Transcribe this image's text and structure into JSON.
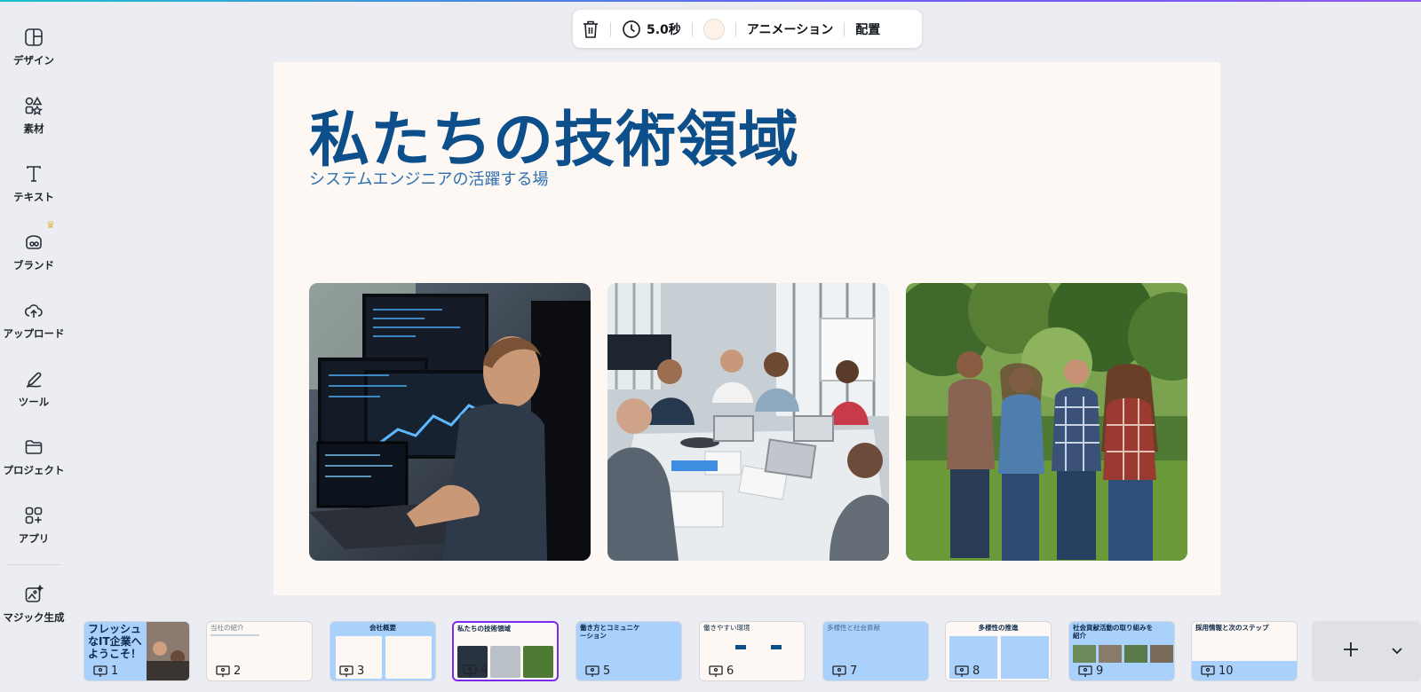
{
  "sidebar": {
    "items": [
      {
        "label": "デザイン",
        "icon": "layout-icon"
      },
      {
        "label": "素材",
        "icon": "shapes-icon"
      },
      {
        "label": "テキスト",
        "icon": "text-icon"
      },
      {
        "label": "ブランド",
        "icon": "brand-icon"
      },
      {
        "label": "アップロード",
        "icon": "cloud-upload-icon"
      },
      {
        "label": "ツール",
        "icon": "pen-tool-icon"
      },
      {
        "label": "プロジェクト",
        "icon": "folder-icon"
      },
      {
        "label": "アプリ",
        "icon": "apps-icon"
      },
      {
        "label": "マジック生成",
        "icon": "magic-image-icon"
      }
    ],
    "crown_icon": "crown-icon"
  },
  "toolbar": {
    "delete_icon": "trash-icon",
    "duration": "5.0秒",
    "animation_label": "アニメーション",
    "position_label": "配置",
    "background_color": "#fdf1e8"
  },
  "slide": {
    "title": "私たちの技術領域",
    "subtitle": "システムエンジニアの活躍する場",
    "background": "#fdf8f4",
    "title_color": "#0c4f8a",
    "photos": [
      "developer-at-monitors-photo",
      "team-meeting-photo",
      "outdoor-team-photo"
    ]
  },
  "thumbnails": [
    {
      "num": "1",
      "title": "フレッシュ\nなIT企業へ\nようこそ！"
    },
    {
      "num": "2",
      "title": "当社の紹介"
    },
    {
      "num": "3",
      "title": "会社概要"
    },
    {
      "num": "4",
      "title": "私たちの技術領域",
      "selected": true
    },
    {
      "num": "5",
      "title": "働き方とコミュニケ\nーション"
    },
    {
      "num": "6",
      "title": "働きやすい環境"
    },
    {
      "num": "7",
      "title": "多様性と社会貢献"
    },
    {
      "num": "8",
      "title": "多様性の推進"
    },
    {
      "num": "9",
      "title": "社会貢献活動の取り組みを\n紹介"
    },
    {
      "num": "10",
      "title": "採用情報と次のステップ"
    }
  ],
  "colors": {
    "accent": "#7d2ae8",
    "thumb_blue": "#a9d1fb"
  }
}
